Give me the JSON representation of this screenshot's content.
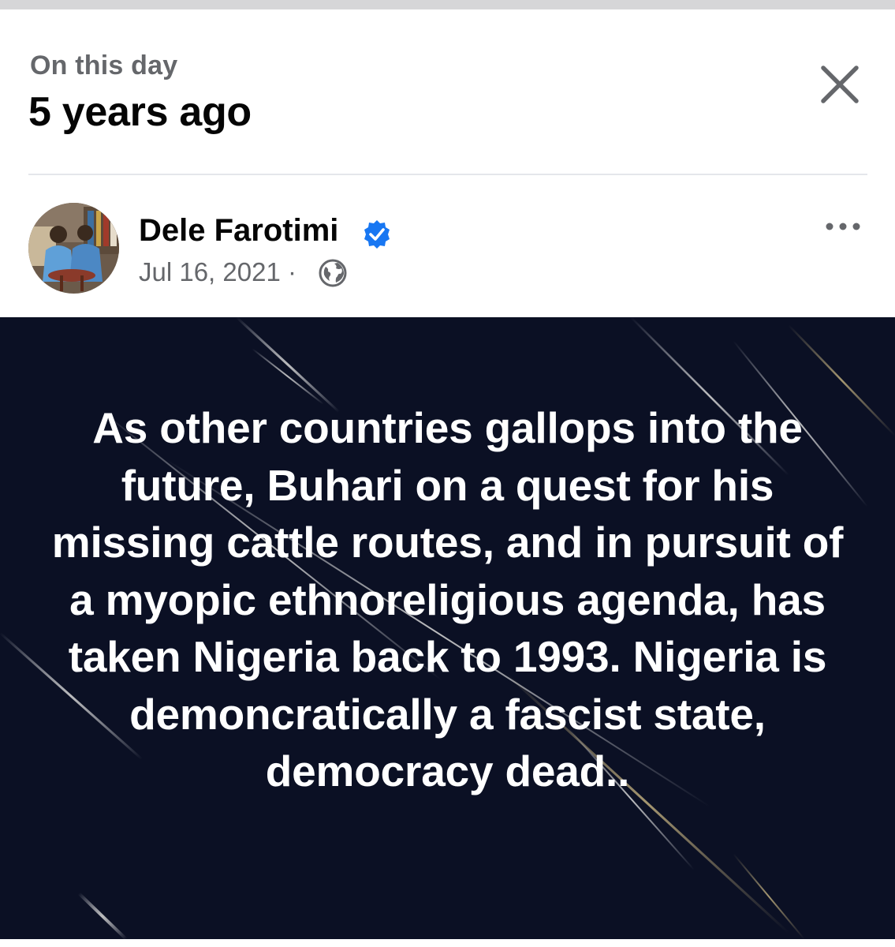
{
  "memory": {
    "label": "On this day",
    "title": "5 years ago"
  },
  "post": {
    "author": "Dele Farotimi",
    "date": "Jul 16, 2021",
    "separator": "·",
    "audience_icon": "globe-icon",
    "verified_icon": "verified-badge-icon",
    "more_icon": "more-options-icon",
    "image_text": "As other countries gallops into the future, Buhari on a quest for his missing cattle routes, and in pursuit of a myopic ethnoreligious agenda, has taken Nigeria back to 1993. Nigeria is demoncratically a fascist state, democracy dead.."
  },
  "icons": {
    "close": "close-icon"
  },
  "colors": {
    "verified": "#1877f2",
    "image_background": "#0b1024",
    "secondary_text": "#65676b",
    "primary_text": "#050505"
  }
}
